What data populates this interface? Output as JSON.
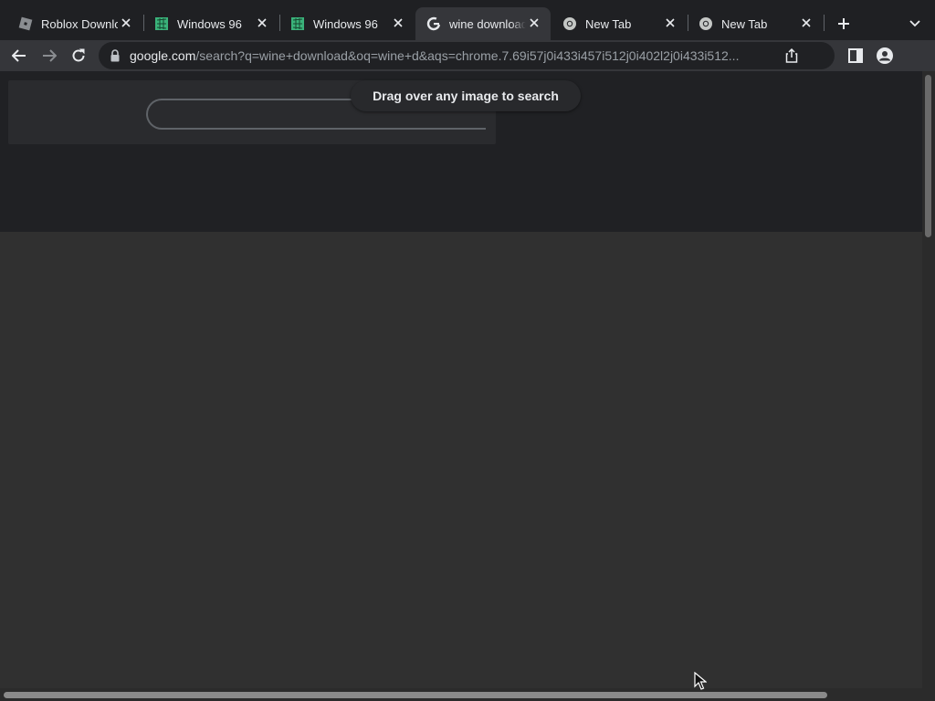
{
  "tabs": [
    {
      "title": "Roblox Downlo",
      "icon": "roblox-icon",
      "active": false
    },
    {
      "title": "Windows 96",
      "icon": "windows96-icon",
      "active": false
    },
    {
      "title": "Windows 96",
      "icon": "windows96-icon",
      "active": false
    },
    {
      "title": "wine download",
      "icon": "google-icon",
      "active": true
    },
    {
      "title": "New Tab",
      "icon": "chrome-icon",
      "active": false
    },
    {
      "title": "New Tab",
      "icon": "chrome-icon",
      "active": false
    }
  ],
  "address_bar": {
    "host": "google.com",
    "path": "/search?q=wine+download&oq=wine+d&aqs=chrome.7.69i57j0i433i457i512j0i402l2j0i433i512..."
  },
  "page": {
    "tooltip": "Drag over any image to search",
    "search_value": ""
  },
  "colors": {
    "tab_strip": "#1f2023",
    "toolbar": "#35363a",
    "page_bg": "#303030",
    "overlay_top": "#202124",
    "windows96_green": "#3ab27a"
  },
  "icons": {
    "back": "arrow-left-icon",
    "forward": "arrow-right-icon",
    "reload": "reload-icon",
    "new_tab": "plus-icon",
    "tab_search": "chevron-down-icon",
    "lock": "lock-icon",
    "share": "share-icon",
    "side_panel": "side-panel-icon",
    "profile": "person-icon",
    "close": "close-icon"
  }
}
